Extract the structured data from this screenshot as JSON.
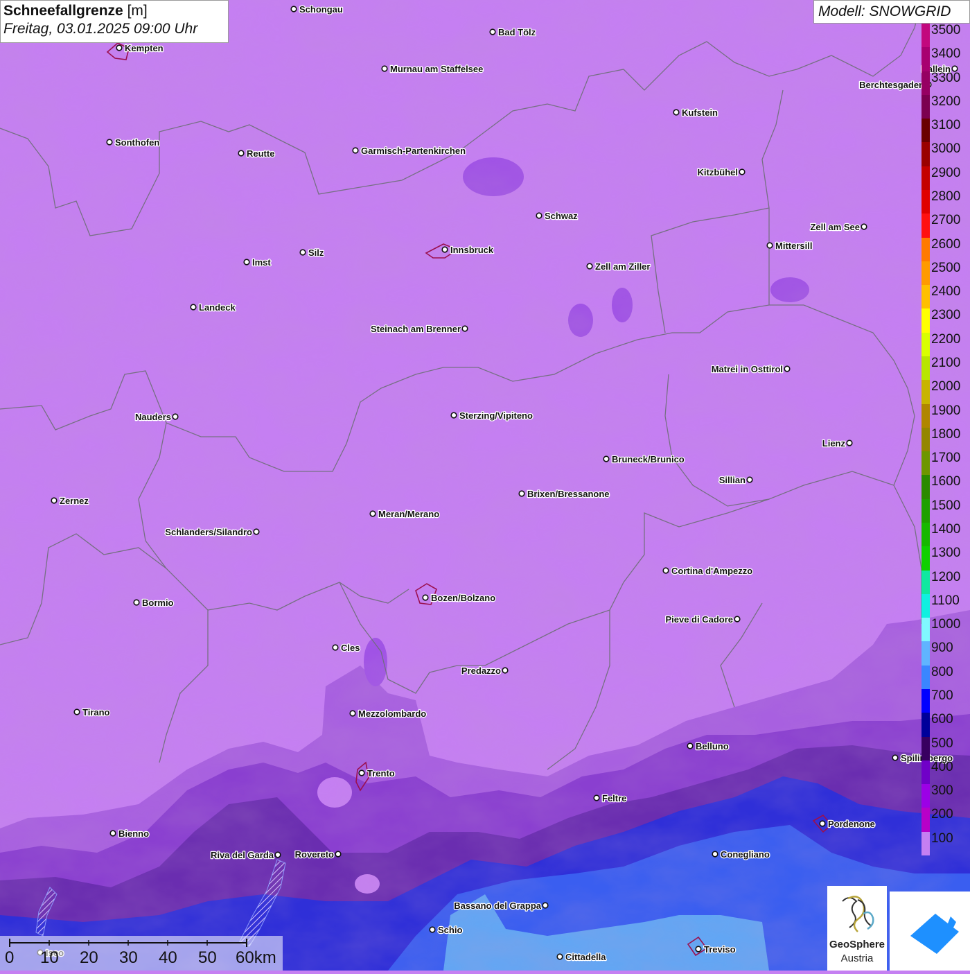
{
  "header": {
    "title": "Schneefallgrenze",
    "unit": "[m]",
    "subtitle": "Freitag, 03.01.2025 09:00 Uhr",
    "model": "Modell: SNOWGRID"
  },
  "legend": {
    "levels": [
      "3500",
      "3400",
      "3300",
      "3200",
      "3100",
      "3000",
      "2900",
      "2800",
      "2700",
      "2600",
      "2500",
      "2400",
      "2300",
      "2200",
      "2100",
      "2000",
      "1900",
      "1800",
      "1700",
      "1600",
      "1500",
      "1400",
      "1300",
      "1200",
      "1100",
      "1000",
      "900",
      "800",
      "700",
      "600",
      "500",
      "400",
      "300",
      "200",
      "100"
    ],
    "colors": [
      "#c2087e",
      "#a80070",
      "#960062",
      "#7c0050",
      "#6a0000",
      "#9a0000",
      "#c40000",
      "#e00000",
      "#ff1010",
      "#ff7a00",
      "#ff9a00",
      "#ffbf00",
      "#ffff00",
      "#d9ff00",
      "#b8e600",
      "#c8b400",
      "#b08600",
      "#948600",
      "#6e9600",
      "#2b8a00",
      "#1ea000",
      "#17b800",
      "#10d000",
      "#10e8a0",
      "#10f0e0",
      "#80f8ff",
      "#60b4ff",
      "#3a86ff",
      "#0000ff",
      "#00009a",
      "#380060",
      "#7000c8",
      "#9c00e6",
      "#b800c8",
      "#c57ff2"
    ]
  },
  "cities": [
    {
      "name": "Schongau"
    },
    {
      "name": "Bad Tölz"
    },
    {
      "name": "Kempten"
    },
    {
      "name": "Murnau am Staffelsee"
    },
    {
      "name": "Hallein"
    },
    {
      "name": "Berchtesgaden"
    },
    {
      "name": "Kufstein"
    },
    {
      "name": "Sonthofen"
    },
    {
      "name": "Reutte"
    },
    {
      "name": "Garmisch-Partenkirchen"
    },
    {
      "name": "Kitzbühel"
    },
    {
      "name": "Schwaz"
    },
    {
      "name": "Zell am See"
    },
    {
      "name": "Innsbruck"
    },
    {
      "name": "Silz"
    },
    {
      "name": "Mittersill"
    },
    {
      "name": "Imst"
    },
    {
      "name": "Zell am Ziller"
    },
    {
      "name": "Landeck"
    },
    {
      "name": "Steinach am Brenner"
    },
    {
      "name": "Matrei in Osttirol"
    },
    {
      "name": "Nauders"
    },
    {
      "name": "Sterzing/Vipiteno"
    },
    {
      "name": "Lienz"
    },
    {
      "name": "Bruneck/Brunico"
    },
    {
      "name": "Sillian"
    },
    {
      "name": "Brixen/Bressanone"
    },
    {
      "name": "Zernez"
    },
    {
      "name": "Meran/Merano"
    },
    {
      "name": "Schlanders/Silandro"
    },
    {
      "name": "Cortina d'Ampezzo"
    },
    {
      "name": "Bormio"
    },
    {
      "name": "Bozen/Bolzano"
    },
    {
      "name": "Pieve di Cadore"
    },
    {
      "name": "Cles"
    },
    {
      "name": "Predazzo"
    },
    {
      "name": "Tirano"
    },
    {
      "name": "Mezzolombardo"
    },
    {
      "name": "Belluno"
    },
    {
      "name": "Spilimbergo"
    },
    {
      "name": "Trento"
    },
    {
      "name": "Feltre"
    },
    {
      "name": "Pordenone"
    },
    {
      "name": "Bienno"
    },
    {
      "name": "Riva del Garda"
    },
    {
      "name": "Rovereto"
    },
    {
      "name": "Conegliano"
    },
    {
      "name": "Bassano del Grappa"
    },
    {
      "name": "Schio"
    },
    {
      "name": "Treviso"
    },
    {
      "name": "Cittadella"
    },
    {
      "name": "Iseo"
    }
  ],
  "scale": {
    "ticks": [
      "0",
      "10",
      "20",
      "30",
      "40",
      "50",
      "60km"
    ]
  },
  "logos": {
    "brand": "GeoSphere",
    "brand_sub": "Austria"
  }
}
